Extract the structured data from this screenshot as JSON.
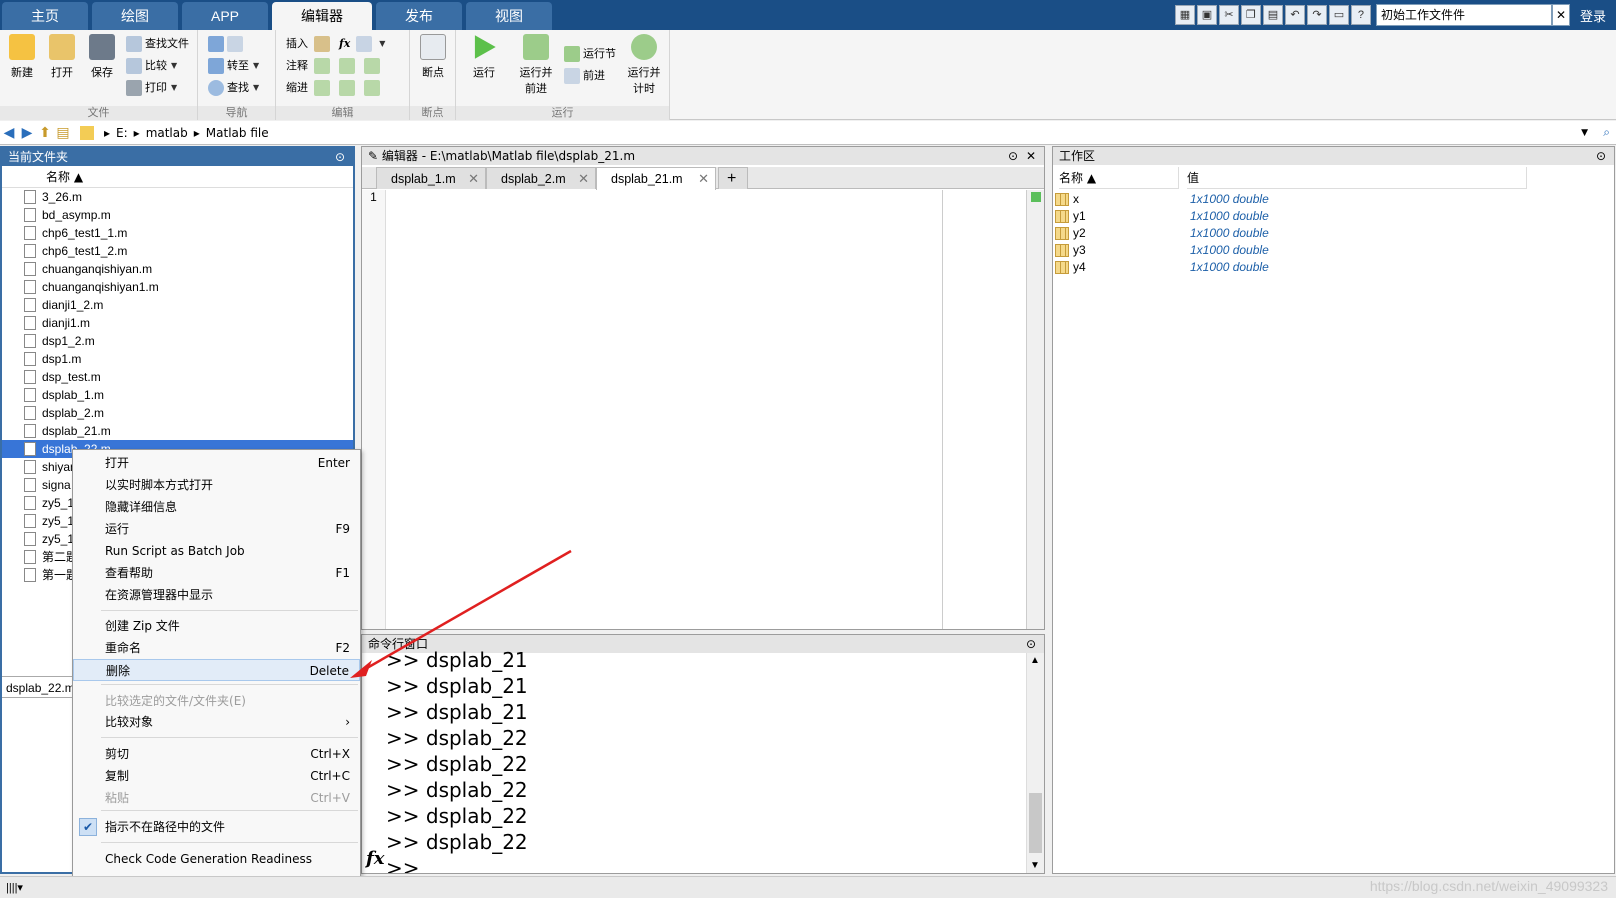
{
  "top_tabs": [
    "主页",
    "绘图",
    "APP",
    "编辑器",
    "发布",
    "视图"
  ],
  "active_tab": "编辑器",
  "quick_search": {
    "value": "初始工作文件件",
    "close": "✕"
  },
  "login": "登录",
  "ribbon": {
    "file": {
      "label": "文件",
      "new": "新建",
      "open": "打开",
      "save": "保存",
      "find_files": "查找文件",
      "compare": "比较",
      "print": "打印"
    },
    "nav": {
      "label": "导航",
      "goto": "转至",
      "find": "查找"
    },
    "edit": {
      "label": "编辑",
      "insert": "插入",
      "comment": "注释",
      "indent": "缩进",
      "fx": "fx"
    },
    "breakpoints": {
      "label": "断点",
      "btn": "断点"
    },
    "run": {
      "label": "运行",
      "run": "运行",
      "run_advance": "运行并\n前进",
      "run_section": "运行节",
      "advance": "前进",
      "run_time": "运行并\n计时"
    }
  },
  "address": {
    "drive": "E:",
    "folder1": "matlab",
    "folder2": "Matlab file"
  },
  "current_folder": {
    "title": "当前文件夹",
    "name_col": "名称 ▲",
    "files": [
      "3_26.m",
      "bd_asymp.m",
      "chp6_test1_1.m",
      "chp6_test1_2.m",
      "chuanganqishiyan.m",
      "chuanganqishiyan1.m",
      "dianji1_2.m",
      "dianji1.m",
      "dsp1_2.m",
      "dsp1.m",
      "dsp_test.m",
      "dsplab_1.m",
      "dsplab_2.m",
      "dsplab_21.m",
      "dsplab_22.m",
      "shiyan",
      "signa",
      "zy5_1",
      "zy5_1",
      "zy5_1",
      "第二题",
      "第一题"
    ],
    "selected_index": 14,
    "detail_name": "dsplab_22.m"
  },
  "editor": {
    "title": "编辑器 - E:\\matlab\\Matlab file\\dsplab_21.m",
    "tabs": [
      "dsplab_1.m",
      "dsplab_2.m",
      "dsplab_21.m"
    ],
    "active_tab": "dsplab_21.m",
    "add_tab": "+",
    "line_number": "1"
  },
  "command_window": {
    "title": "命令行窗口",
    "lines": [
      ">> dsplab_21",
      ">> dsplab_21",
      ">> dsplab_21",
      ">> dsplab_22",
      ">> dsplab_22",
      ">> dsplab_22",
      ">> dsplab_22",
      ">> dsplab_22",
      ">>"
    ],
    "fx": "fx"
  },
  "workspace": {
    "title": "工作区",
    "name_col": "名称 ▲",
    "value_col": "值",
    "vars": [
      {
        "name": "x",
        "value": "1x1000 double"
      },
      {
        "name": "y1",
        "value": "1x1000 double"
      },
      {
        "name": "y2",
        "value": "1x1000 double"
      },
      {
        "name": "y3",
        "value": "1x1000 double"
      },
      {
        "name": "y4",
        "value": "1x1000 double"
      }
    ]
  },
  "context_menu": {
    "items": [
      {
        "label": "打开",
        "shortcut": "Enter"
      },
      {
        "label": "以实时脚本方式打开",
        "shortcut": ""
      },
      {
        "label": "隐藏详细信息",
        "shortcut": ""
      },
      {
        "label": "运行",
        "shortcut": "F9"
      },
      {
        "label": "Run Script as Batch Job",
        "shortcut": ""
      },
      {
        "label": "查看帮助",
        "shortcut": "F1"
      },
      {
        "label": "在资源管理器中显示",
        "shortcut": ""
      },
      {
        "label": "创建 Zip 文件",
        "shortcut": ""
      },
      {
        "label": "重命名",
        "shortcut": "F2"
      },
      {
        "label": "删除",
        "shortcut": "Delete"
      },
      {
        "label": "比较选定的文件/文件夹(E)",
        "shortcut": ""
      },
      {
        "label": "比较对象",
        "shortcut": "›"
      },
      {
        "label": "剪切",
        "shortcut": "Ctrl+X"
      },
      {
        "label": "复制",
        "shortcut": "Ctrl+C"
      },
      {
        "label": "粘贴",
        "shortcut": "Ctrl+V"
      },
      {
        "label": "指示不在路径中的文件",
        "shortcut": ""
      },
      {
        "label": "Check Code Generation Readiness",
        "shortcut": ""
      }
    ]
  },
  "watermark": "https://blog.csdn.net/weixin_49099323",
  "colors": {
    "title_bar": "#1a4e86",
    "selection": "#3875d7",
    "arrow": "#e02020"
  }
}
